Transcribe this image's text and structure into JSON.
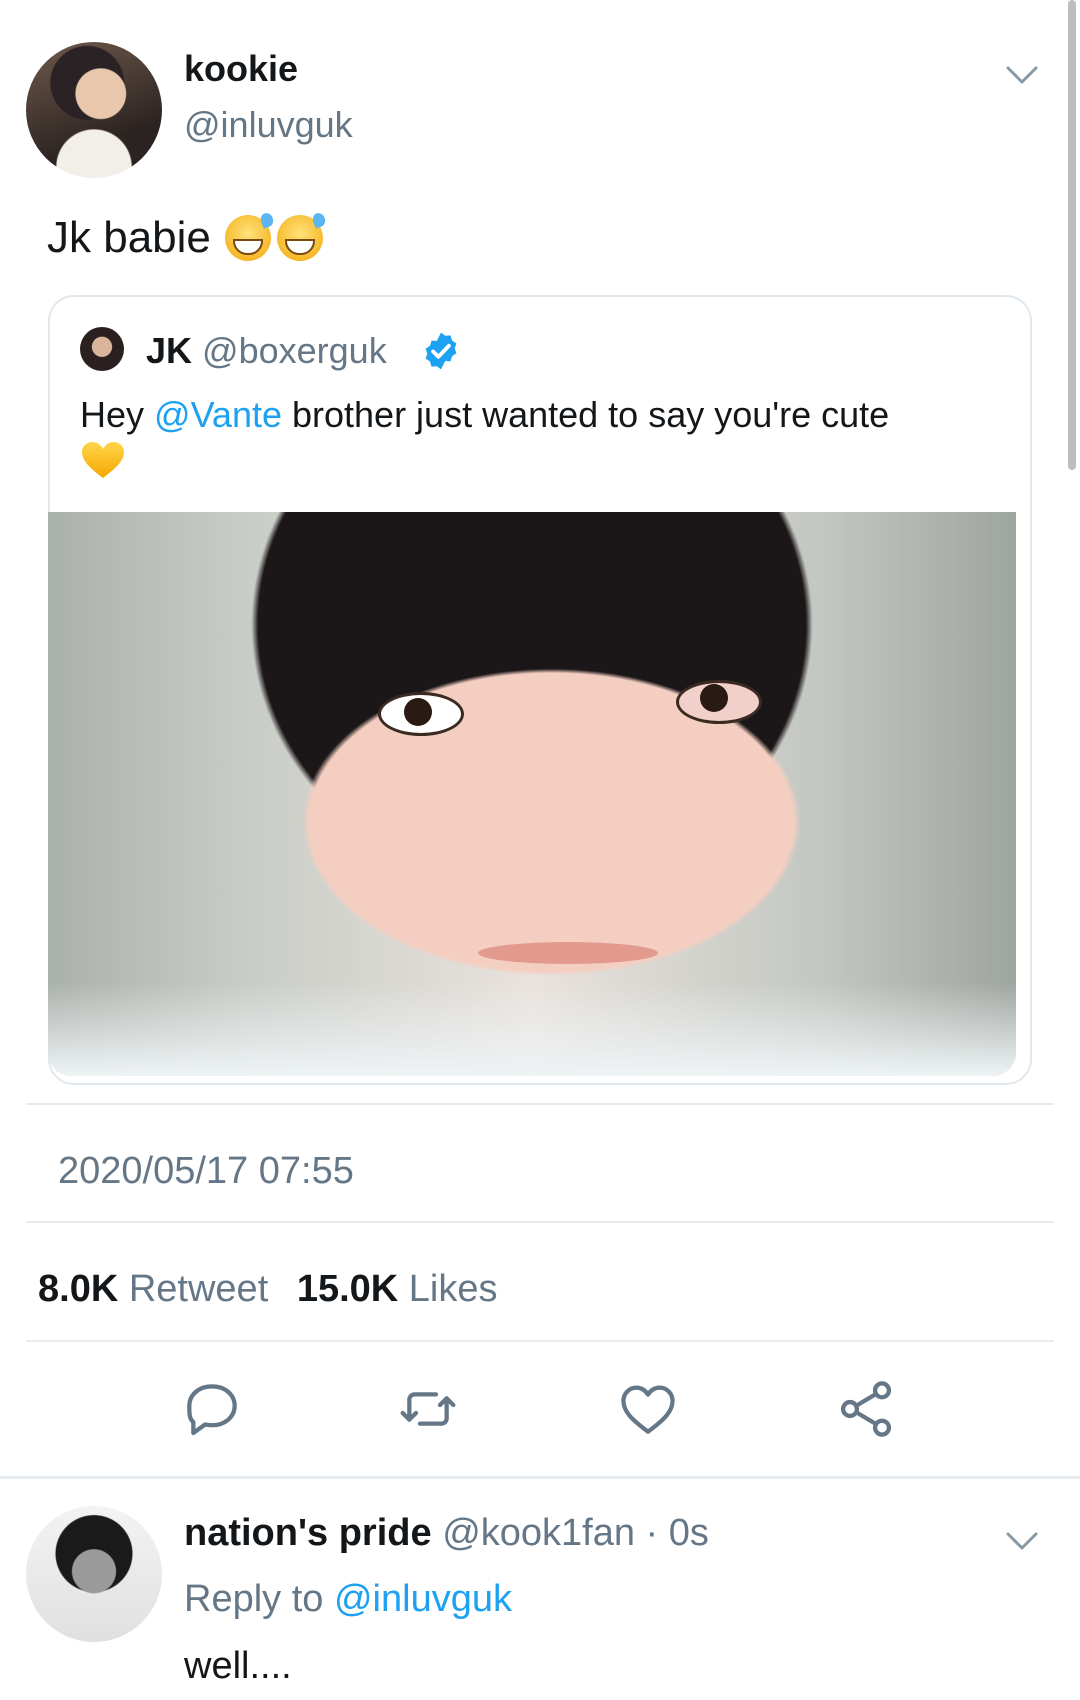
{
  "tweet": {
    "author_name": "kookie",
    "author_handle": "@inluvguk",
    "text": "Jk babie",
    "emoji_icons": [
      "grinning-sweat-emoji",
      "grinning-sweat-emoji"
    ]
  },
  "quoted": {
    "name": "JK",
    "handle": "@boxerguk",
    "verified_icon": "verified-badge-icon",
    "text_before": "Hey ",
    "mention": "@Vante",
    "text_after": " brother just wanted to say you're cute",
    "emoji_icon": "yellow-heart-emoji"
  },
  "timestamp": "2020/05/17 07:55",
  "stats": {
    "retweets_count": "8.0K",
    "retweets_label": "Retweet",
    "likes_count": "15.0K",
    "likes_label": "Likes"
  },
  "actions": [
    "reply-icon",
    "retweet-icon",
    "like-icon",
    "share-icon"
  ],
  "reply": {
    "name": "nation's pride",
    "handle": "@kook1fan",
    "separator": " · ",
    "time": "0s",
    "reply_to_label": "Reply to ",
    "reply_to_handle": "@inluvguk",
    "text": "well...."
  },
  "colors": {
    "accent": "#1da1f2",
    "secondary_text": "#657786",
    "primary_text": "#14171a",
    "divider": "#e6ecf0"
  }
}
